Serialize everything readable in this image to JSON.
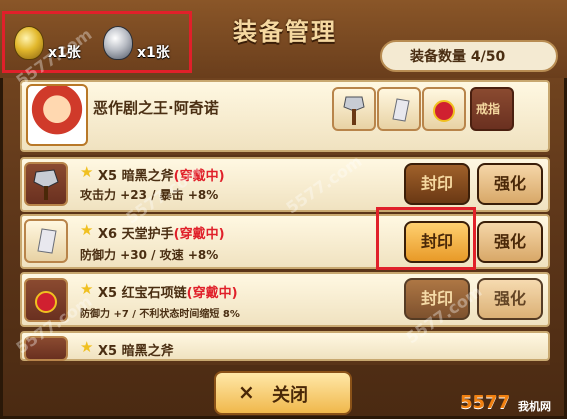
{
  "header": {
    "title": "装备管理",
    "equip_count": "装备数量 4/50"
  },
  "currency": [
    {
      "icon": "gold-seal-coin-icon",
      "value": "x1张"
    },
    {
      "icon": "silver-seal-coin-icon",
      "value": "x1张"
    }
  ],
  "hero": {
    "name": "恶作剧之王·阿奇诺",
    "slots": [
      {
        "icon": "axe-icon"
      },
      {
        "icon": "gauntlet-icon"
      },
      {
        "icon": "ruby-necklace-icon"
      },
      {
        "label": "戒指"
      }
    ]
  },
  "items": [
    {
      "icon": "axe-icon",
      "level": "X5",
      "name": "暗黑之斧",
      "status": "(穿戴中)",
      "stats": "攻击力 +23 / 暴击 +8%",
      "seal": "封印",
      "enhance": "强化"
    },
    {
      "icon": "gauntlet-icon",
      "level": "X6",
      "name": "天堂护手",
      "status": "(穿戴中)",
      "stats": "防御力 +30 / 攻速 +8%",
      "seal": "封印",
      "enhance": "强化"
    },
    {
      "icon": "ruby-necklace-icon",
      "level": "X5",
      "name": "红宝石项链",
      "status": "(穿戴中)",
      "stats": "防御力 +7 / 不利状态时间缩短 8%",
      "seal": "封印",
      "enhance": "强化"
    },
    {
      "icon": "axe-icon",
      "level": "X5",
      "name": "暗黑之斧",
      "status": "",
      "stats": "",
      "seal": "",
      "enhance": ""
    }
  ],
  "footer": {
    "close_icon": "×",
    "close_label": "关闭"
  },
  "watermark": "5577.com",
  "brand": {
    "logo": "5577",
    "site": "我机网"
  },
  "colors": {
    "equipped": "#e0202a",
    "accent": "#f0b84c"
  }
}
